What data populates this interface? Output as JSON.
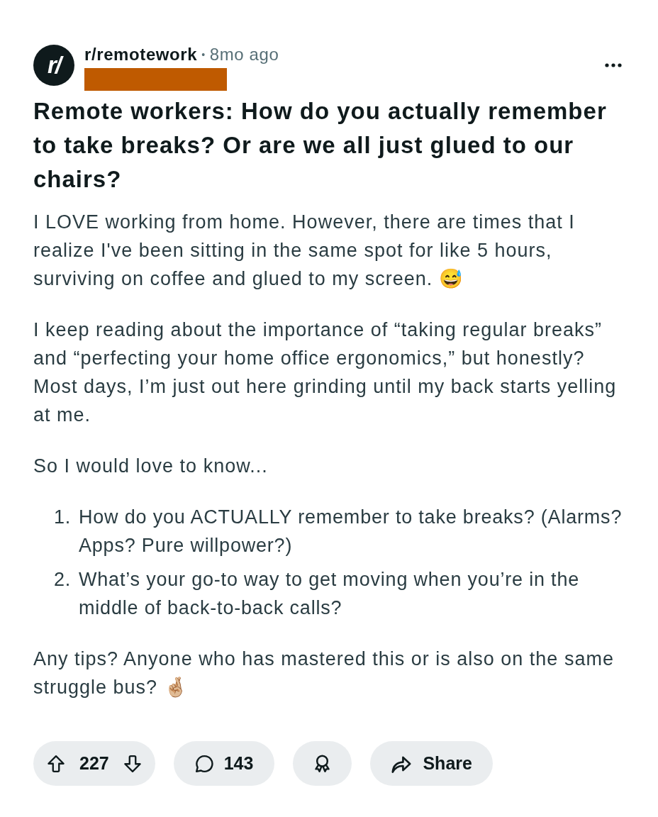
{
  "post": {
    "avatar_text": "r/",
    "subreddit": "r/remotework",
    "separator": "•",
    "time": "8mo ago",
    "title": "Remote workers: How do you actually remember to take breaks? Or are we all just glued to our chairs?"
  },
  "body": [
    {
      "kind": "paragraph",
      "text": "I LOVE working from home. However, there are times that I realize I've been sitting in the same spot for like 5 hours, surviving on coffee and glued to my screen. 😅"
    },
    {
      "kind": "paragraph",
      "text": "I keep reading about the importance of “taking regular breaks” and “perfecting your home office ergonomics,” but honestly? Most days, I’m just out here grinding until my back starts yelling at me."
    },
    {
      "kind": "paragraph",
      "text": "So I would love to know..."
    },
    {
      "kind": "ordered_list",
      "items": [
        {
          "number": "1.",
          "text": "How do you ACTUALLY remember to take breaks? (Alarms? Apps? Pure willpower?)"
        },
        {
          "number": "2.",
          "text": "What’s your go-to way to get moving when you’re in the middle of back-to-back calls?"
        }
      ]
    },
    {
      "kind": "paragraph",
      "text": "Any tips? Anyone who has mastered this or is also on the same struggle bus? 🤞🏼"
    }
  ],
  "actions": [
    {
      "kind": "vote",
      "count": "227"
    },
    {
      "kind": "comments",
      "count": "143"
    },
    {
      "kind": "award"
    },
    {
      "kind": "share",
      "label": "Share"
    }
  ]
}
